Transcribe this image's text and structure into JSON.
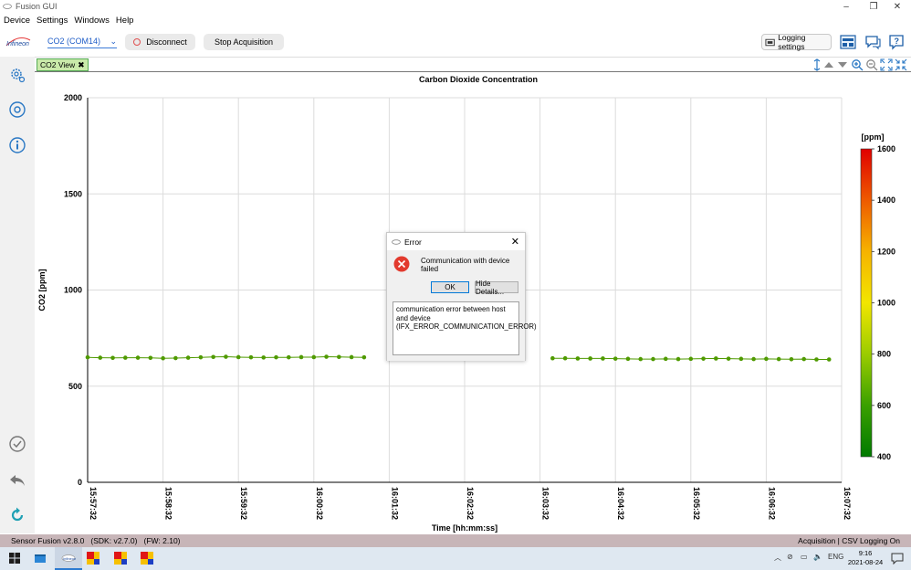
{
  "window": {
    "title": "Fusion GUI",
    "minimize": "–",
    "restore": "❐",
    "close": "✕"
  },
  "menu": [
    "Device",
    "Settings",
    "Windows",
    "Help"
  ],
  "toolbar": {
    "logo_text": "Infineon",
    "device_select": "CO2 (COM14)",
    "disconnect_label": "Disconnect",
    "stop_label": "Stop Acquisition",
    "logging_label": "Logging settings"
  },
  "sidebar": [
    "settings-icon",
    "plus-circle-icon",
    "info-icon",
    "check-circle-icon",
    "back-arrow-icon",
    "refresh-icon"
  ],
  "view_tab": {
    "label": "CO2 View",
    "close": "✖"
  },
  "chart_data": {
    "type": "line",
    "title": "Carbon Dioxide Concentration",
    "xlabel": "Time [hh:mm:ss]",
    "ylabel": "CO2 [ppm]",
    "ylim": [
      0,
      2000
    ],
    "yticks": [
      0,
      500,
      1000,
      1500,
      2000
    ],
    "xticks": [
      "15:57:32",
      "15:58:32",
      "15:59:32",
      "16:00:32",
      "16:01:32",
      "16:02:32",
      "16:03:32",
      "16:04:32",
      "16:05:32",
      "16:06:32",
      "16:07:32"
    ],
    "x_start_seconds": 0,
    "x_end_seconds": 600,
    "grid": true,
    "series": [
      {
        "color": "#4f9a00",
        "points": [
          [
            0,
            650
          ],
          [
            10,
            648
          ],
          [
            20,
            647
          ],
          [
            30,
            648
          ],
          [
            40,
            648
          ],
          [
            50,
            647
          ],
          [
            60,
            645
          ],
          [
            70,
            646
          ],
          [
            80,
            648
          ],
          [
            90,
            650
          ],
          [
            100,
            652
          ],
          [
            110,
            653
          ],
          [
            120,
            651
          ],
          [
            130,
            650
          ],
          [
            140,
            649
          ],
          [
            150,
            650
          ],
          [
            160,
            650
          ],
          [
            170,
            651
          ],
          [
            180,
            651
          ],
          [
            190,
            653
          ],
          [
            200,
            652
          ],
          [
            210,
            651
          ],
          [
            220,
            650
          ],
          [
            370,
            645
          ],
          [
            380,
            645
          ],
          [
            390,
            644
          ],
          [
            400,
            644
          ],
          [
            410,
            644
          ],
          [
            420,
            643
          ],
          [
            430,
            642
          ],
          [
            440,
            641
          ],
          [
            450,
            641
          ],
          [
            460,
            642
          ],
          [
            470,
            641
          ],
          [
            480,
            642
          ],
          [
            490,
            643
          ],
          [
            500,
            644
          ],
          [
            510,
            643
          ],
          [
            520,
            642
          ],
          [
            530,
            641
          ],
          [
            540,
            642
          ],
          [
            550,
            641
          ],
          [
            560,
            640
          ],
          [
            570,
            641
          ],
          [
            580,
            639
          ],
          [
            590,
            639
          ]
        ]
      }
    ],
    "colorbar": {
      "unit": "[ppm]",
      "min": 400,
      "max": 1600,
      "ticks": [
        400,
        600,
        800,
        1000,
        1200,
        1400,
        1600
      ],
      "colors": [
        "#007a00",
        "#3aa000",
        "#9bcc00",
        "#f2e600",
        "#f6b300",
        "#ee5a00",
        "#e00000"
      ]
    }
  },
  "dialog": {
    "title": "Error",
    "message": "Communication with device failed",
    "ok_label": "OK",
    "details_label": "Hide Details...",
    "details_text": "communication error between host and device (IFX_ERROR_COMMUNICATION_ERROR)"
  },
  "status": {
    "left": "Sensor Fusion v2.8.0   (SDK: v2.7.0)   (FW: 2.10)",
    "right": "Acquisition | CSV Logging On"
  },
  "taskbar": {
    "language": "ENG",
    "time": "9:16",
    "date": "2021-08-24"
  }
}
